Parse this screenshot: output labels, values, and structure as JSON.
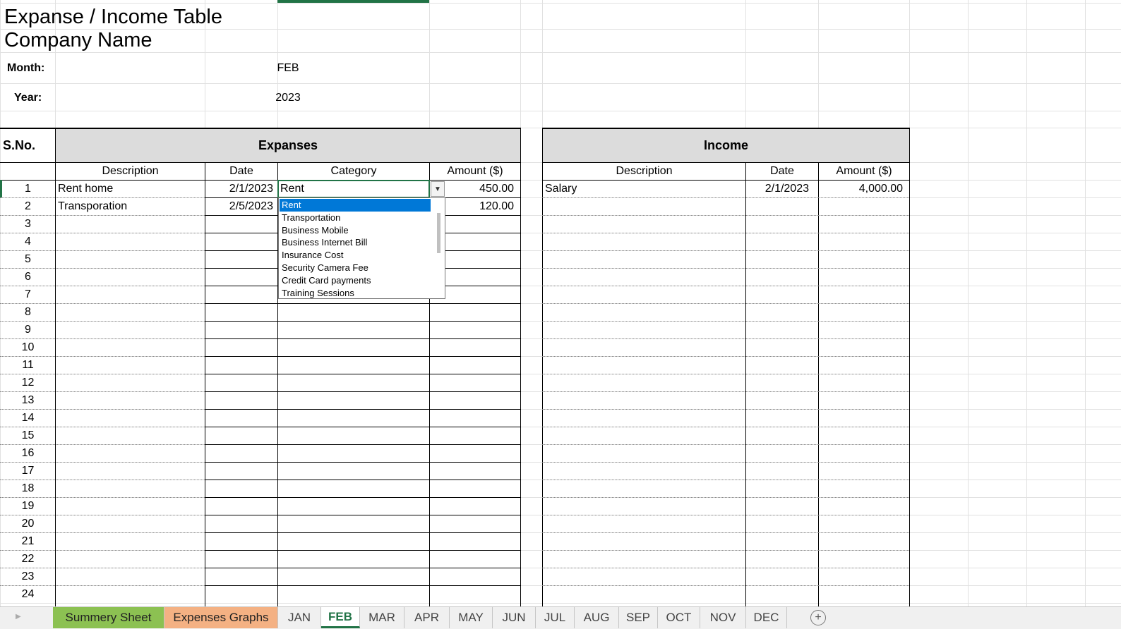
{
  "title": "Expanse / Income Table",
  "company": "Company Name",
  "month_label": "Month:",
  "month_value": "FEB",
  "year_label": "Year:",
  "year_value": "2023",
  "sno_header": "S.No.",
  "expenses": {
    "header": "Expanses",
    "columns": [
      "Description",
      "Date",
      "Category",
      "Amount ($)"
    ],
    "rows": [
      {
        "sno": "1",
        "description": "Rent home",
        "date": "2/1/2023",
        "category": "Rent",
        "amount": "450.00"
      },
      {
        "sno": "2",
        "description": "Transporation",
        "date": "2/5/2023",
        "category": "",
        "amount": "120.00"
      }
    ]
  },
  "income": {
    "header": "Income",
    "columns": [
      "Description",
      "Date",
      "Amount ($)"
    ],
    "rows": [
      {
        "description": "Salary",
        "date": "2/1/2023",
        "amount": "4,000.00"
      }
    ]
  },
  "row_numbers": [
    "1",
    "2",
    "3",
    "4",
    "5",
    "6",
    "7",
    "8",
    "9",
    "10",
    "11",
    "12",
    "13",
    "14",
    "15",
    "16",
    "17",
    "18",
    "19",
    "20",
    "21",
    "22",
    "23",
    "24"
  ],
  "dropdown": {
    "selected": "Rent",
    "options": [
      "Rent",
      "Transportation",
      "Business Mobile",
      "Business Internet Bill",
      "Insurance Cost",
      "Security Camera Fee",
      "Credit Card payments",
      "Training Sessions"
    ]
  },
  "tabs": [
    {
      "label": "Summery Sheet",
      "color": "#8cc152"
    },
    {
      "label": "Expenses Graphs",
      "color": "#f4b183"
    },
    {
      "label": "JAN"
    },
    {
      "label": "FEB",
      "active": true
    },
    {
      "label": "MAR"
    },
    {
      "label": "APR"
    },
    {
      "label": "MAY"
    },
    {
      "label": "JUN"
    },
    {
      "label": "JUL"
    },
    {
      "label": "AUG"
    },
    {
      "label": "SEP"
    },
    {
      "label": "OCT"
    },
    {
      "label": "NOV"
    },
    {
      "label": "DEC"
    }
  ],
  "icons": {
    "add_sheet": "plus-circle-icon",
    "scroll": "triangle-right-icon",
    "dropdown": "chevron-down-icon"
  },
  "colors": {
    "active_tab_text": "#217346",
    "header_fill": "#dcdcdc",
    "dropdown_highlight": "#0078d7"
  }
}
